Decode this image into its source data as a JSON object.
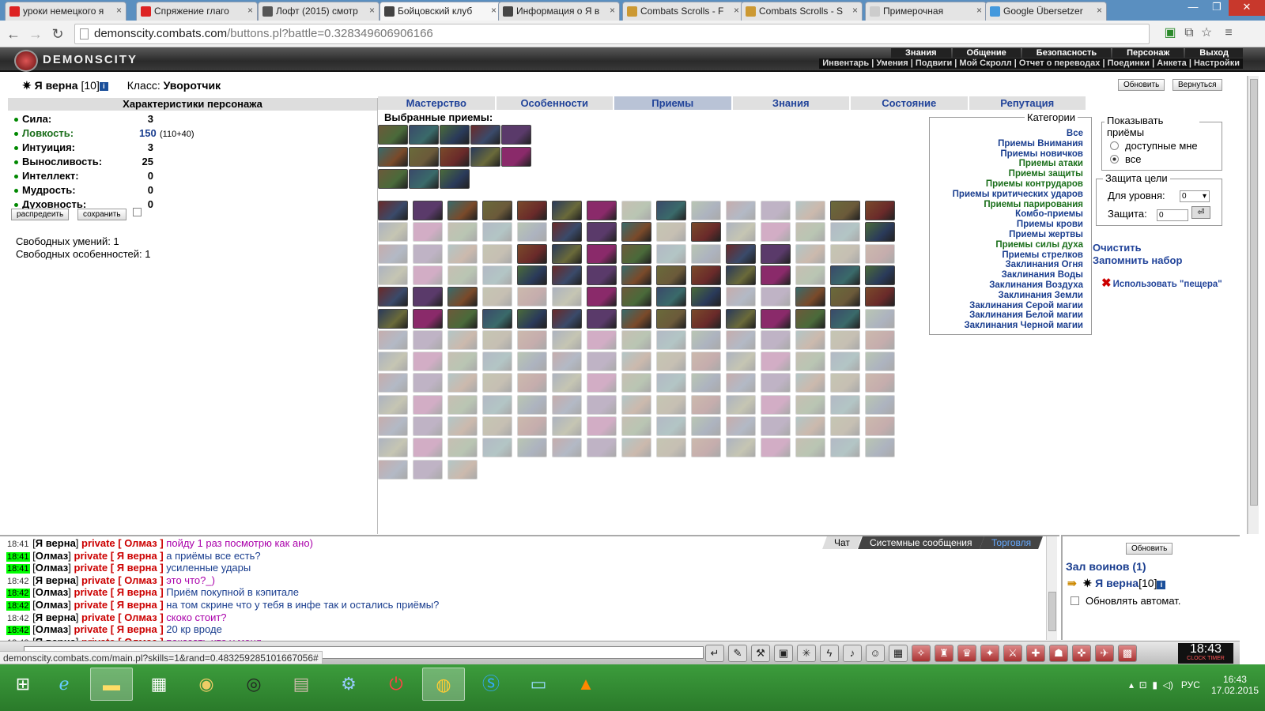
{
  "browser": {
    "tabs": [
      {
        "label": "уроки немецкого я",
        "color": "#d22"
      },
      {
        "label": "Спряжение глаго",
        "color": "#d22"
      },
      {
        "label": "Лофт (2015) смотр",
        "color": "#555"
      },
      {
        "label": "Бойцовский клуб",
        "color": "#444",
        "active": true
      },
      {
        "label": "Информация о Я в",
        "color": "#444"
      },
      {
        "label": "Combats Scrolls - F",
        "color": "#c93"
      },
      {
        "label": "Combats Scrolls - S",
        "color": "#c93"
      },
      {
        "label": "Примерочная",
        "color": "#ccc"
      },
      {
        "label": "Google Übersetzer",
        "color": "#49d"
      }
    ],
    "url_host": "demonscity.combats.com",
    "url_path": "/buttons.pl?battle=0.328349606906166",
    "status_url": "demonscity.combats.com/main.pl?skills=1&rand=0.483259285101667056#"
  },
  "site": {
    "logo": "DEMONSCITY",
    "top_menu": [
      "Знания",
      "Общение",
      "Безопасность",
      "Персонаж",
      "Выход"
    ],
    "sub_menu": "Инвентарь | Умения | Подвиги | Мой Скролл | Отчет о переводах | Поединки | Анкета | Настройки"
  },
  "character": {
    "name": "Я верна",
    "level": "[10]",
    "info_icon": "i",
    "class_label": "Класс:",
    "class_value": "Уворотчик",
    "refresh": "Обновить",
    "back": "Вернуться",
    "panel_title": "Характеристики персонажа",
    "stats": [
      {
        "label": "Сила:",
        "value": "3"
      },
      {
        "label": "Ловкость:",
        "value": "150",
        "extra": "(110+40)"
      },
      {
        "label": "Интуиция:",
        "value": "3"
      },
      {
        "label": "Выносливость:",
        "value": "25"
      },
      {
        "label": "Интеллект:",
        "value": "0"
      },
      {
        "label": "Мудрость:",
        "value": "0"
      },
      {
        "label": "Духовность:",
        "value": "0"
      }
    ],
    "distribute": "распредеить",
    "save": "сохранить",
    "free_skills": "Свободных умений: 1",
    "free_features": "Свободных особенностей: 1"
  },
  "tabs": [
    "Мастерство",
    "Особенности",
    "Приемы",
    "Знания",
    "Состояние",
    "Репутация"
  ],
  "selected_tab": 2,
  "selected_title": "Выбранные приемы:",
  "categories": {
    "legend": "Категории",
    "items": [
      {
        "label": "Все",
        "color": "blue"
      },
      {
        "label": "Приемы Внимания",
        "color": "blue"
      },
      {
        "label": "Приемы новичков",
        "color": "blue"
      },
      {
        "label": "Приемы атаки",
        "color": "green"
      },
      {
        "label": "Приемы защиты",
        "color": "green"
      },
      {
        "label": "Приемы контрударов",
        "color": "green"
      },
      {
        "label": "Приемы критических ударов",
        "color": "blue"
      },
      {
        "label": "Приемы парирования",
        "color": "green"
      },
      {
        "label": "Комбо-приемы",
        "color": "blue"
      },
      {
        "label": "Приемы крови",
        "color": "blue"
      },
      {
        "label": "Приемы жертвы",
        "color": "blue"
      },
      {
        "label": "Приемы силы духа",
        "color": "green"
      },
      {
        "label": "Приемы стрелков",
        "color": "blue"
      },
      {
        "label": "Заклинания Огня",
        "color": "blue"
      },
      {
        "label": "Заклинания Воды",
        "color": "blue"
      },
      {
        "label": "Заклинания Воздуха",
        "color": "blue"
      },
      {
        "label": "Заклинания Земли",
        "color": "blue"
      },
      {
        "label": "Заклинания Серой магии",
        "color": "blue"
      },
      {
        "label": "Заклинания Белой магии",
        "color": "blue"
      },
      {
        "label": "Заклинания Черной магии",
        "color": "blue"
      }
    ]
  },
  "show": {
    "legend": "Показывать приёмы",
    "option_available": "доступные мне",
    "option_all": "все",
    "selected": "all"
  },
  "protect": {
    "legend": "Защита цели",
    "level_label": "Для уровня:",
    "level_value": "0",
    "protect_label": "Защита:",
    "protect_value": "0"
  },
  "actions": {
    "clear": "Очистить",
    "remember": "Запомнить набор",
    "use_cave": "Использовать \"пещера\""
  },
  "chat": {
    "tabs": [
      "Чат",
      "Системные сообщения",
      "Торговля"
    ],
    "private": "private",
    "messages": [
      {
        "time": "18:41",
        "hl": false,
        "from": "Я верна",
        "to": "Олмаз",
        "text": "пойду 1 раз посмотрю как ано)",
        "style": "a"
      },
      {
        "time": "18:41",
        "hl": true,
        "from": "Олмаз",
        "to": "Я верна",
        "text": "а приёмы все есть?",
        "style": "b"
      },
      {
        "time": "18:41",
        "hl": true,
        "from": "Олмаз",
        "to": "Я верна",
        "text": "усиленные удары",
        "style": "b"
      },
      {
        "time": "18:42",
        "hl": false,
        "from": "Я верна",
        "to": "Олмаз",
        "text": "это что?_)",
        "style": "a"
      },
      {
        "time": "18:42",
        "hl": true,
        "from": "Олмаз",
        "to": "Я верна",
        "text": "Приём покупной в кэпитале",
        "style": "b"
      },
      {
        "time": "18:42",
        "hl": true,
        "from": "Олмаз",
        "to": "Я верна",
        "text": "на том скрине что у тебя в инфе так и остались приёмы?",
        "style": "b"
      },
      {
        "time": "18:42",
        "hl": false,
        "from": "Я верна",
        "to": "Олмаз",
        "text": "скоко стоит?",
        "style": "a"
      },
      {
        "time": "18:42",
        "hl": true,
        "from": "Олмаз",
        "to": "Я верна",
        "text": "20 кр вроде",
        "style": "b"
      },
      {
        "time": "18:43",
        "hl": false,
        "from": "Я верна",
        "to": "Олмаз",
        "text": "показать что у меня",
        "style": "a"
      }
    ]
  },
  "hall": {
    "refresh": "Обновить",
    "title": "Зал воинов (1)",
    "user": "Я верна",
    "user_level": "[10]",
    "auto_refresh": "Обновлять автомат."
  },
  "clock": {
    "time": "18:43",
    "sub": "CLOCK TIMER"
  },
  "taskbar": {
    "lang": "РУС",
    "time": "16:43",
    "date": "17.02.2015"
  },
  "colors": {
    "link_blue": "#1a3e8f",
    "link_green": "#1a6e1a",
    "taskbar": "#2f8a2f",
    "chat_private": "#cc0000"
  }
}
